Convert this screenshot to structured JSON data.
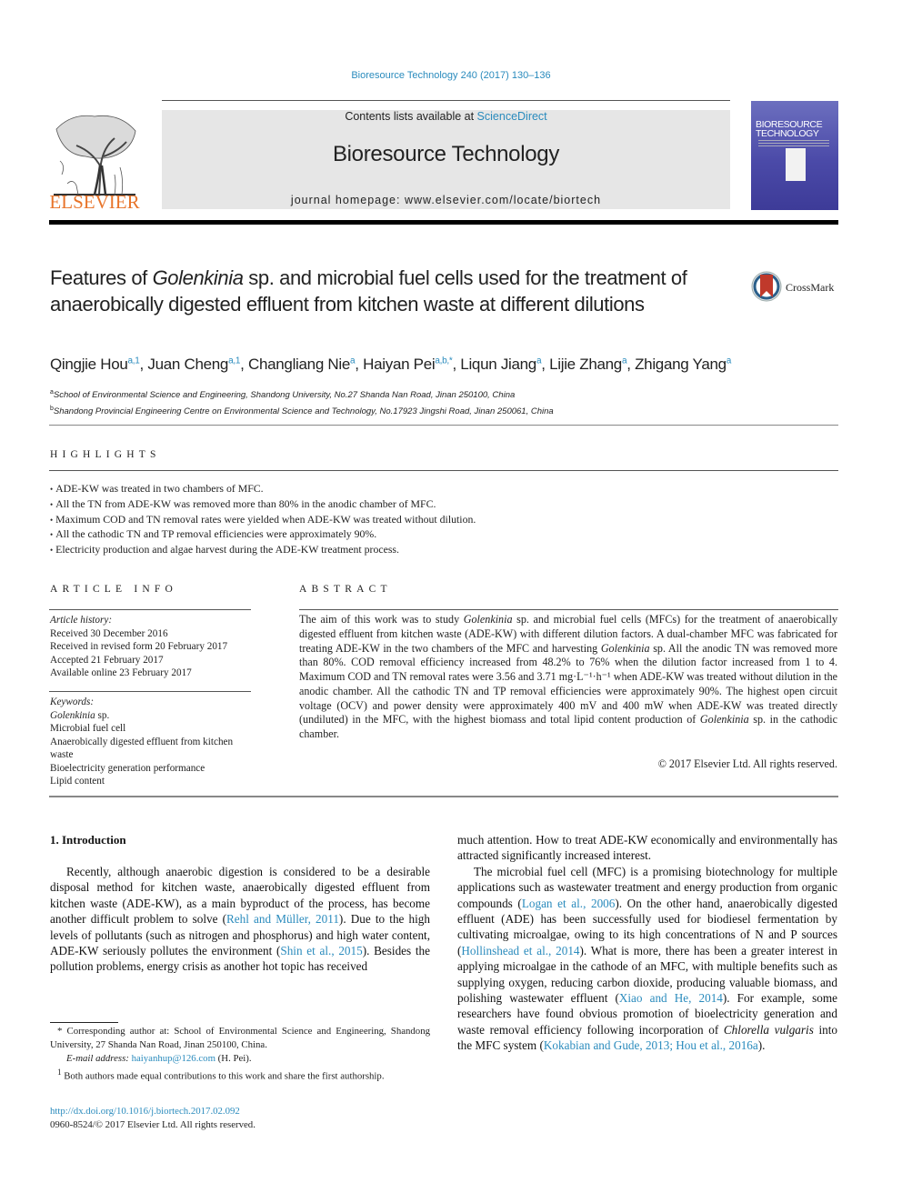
{
  "running_head": "Bioresource Technology 240 (2017) 130–136",
  "masthead": {
    "contents_prefix": "Contents lists available at ",
    "contents_link": "ScienceDirect",
    "journal_title": "Bioresource Technology",
    "homepage": "journal homepage: www.elsevier.com/locate/biortech",
    "publisher": "ELSEVIER",
    "cover_title_line1": "BIORESOURCE",
    "cover_title_line2": "TECHNOLOGY"
  },
  "crossmark_label": "CrossMark",
  "title": {
    "pre": "Features of ",
    "italic": "Golenkinia",
    "post": " sp. and microbial fuel cells used for the treatment of anaerobically digested effluent from kitchen waste at different dilutions"
  },
  "authors": [
    {
      "name": "Qingjie Hou",
      "sup": "a,1"
    },
    {
      "name": "Juan Cheng",
      "sup": "a,1"
    },
    {
      "name": "Changliang Nie",
      "sup": "a"
    },
    {
      "name": "Haiyan Pei",
      "sup": "a,b,*"
    },
    {
      "name": "Liqun Jiang",
      "sup": "a"
    },
    {
      "name": "Lijie Zhang",
      "sup": "a"
    },
    {
      "name": "Zhigang Yang",
      "sup": "a"
    }
  ],
  "affiliations": [
    {
      "mark": "a",
      "text": "School of Environmental Science and Engineering, Shandong University, No.27 Shanda Nan Road, Jinan 250100, China"
    },
    {
      "mark": "b",
      "text": "Shandong Provincial Engineering Centre on Environmental Science and Technology, No.17923 Jingshi Road, Jinan 250061, China"
    }
  ],
  "highlights": {
    "heading": "HIGHLIGHTS",
    "items": [
      "ADE-KW was treated in two chambers of MFC.",
      "All the TN from ADE-KW was removed more than 80% in the anodic chamber of MFC.",
      "Maximum COD and TN removal rates were yielded when ADE-KW was treated without dilution.",
      "All the cathodic TN and TP removal efficiencies were approximately 90%.",
      "Electricity production and algae harvest during the ADE-KW treatment process."
    ]
  },
  "article_info": {
    "heading": "ARTICLE INFO",
    "history_label": "Article history:",
    "history": [
      "Received 30 December 2016",
      "Received in revised form 20 February 2017",
      "Accepted 21 February 2017",
      "Available online 23 February 2017"
    ],
    "keywords_label": "Keywords:",
    "keyword_first_italic": "Golenkinia",
    "keyword_first_rest": " sp.",
    "keywords": [
      "Microbial fuel cell",
      "Anaerobically digested effluent from kitchen waste",
      "Bioelectricity generation performance",
      "Lipid content"
    ]
  },
  "abstract": {
    "heading": "ABSTRACT",
    "p1": "The aim of this work was to study ",
    "i1": "Golenkinia",
    "p2": " sp. and microbial fuel cells (MFCs) for the treatment of anaerobically digested effluent from kitchen waste (ADE-KW) with different dilution factors. A dual-chamber MFC was fabricated for treating ADE-KW in the two chambers of the MFC and harvesting ",
    "i2": "Golenkinia",
    "p3": " sp. All the anodic TN was removed more than 80%. COD removal efficiency increased from 48.2% to 76% when the dilution factor increased from 1 to 4. Maximum COD and TN removal rates were 3.56 and 3.71 mg·L⁻¹·h⁻¹ when ADE-KW was treated without dilution in the anodic chamber. All the cathodic TN and TP removal efficiencies were approximately 90%. The highest open circuit voltage (OCV) and power density were approximately 400 mV and 400 mW when ADE-KW was treated directly (undiluted) in the MFC, with the highest biomass and total lipid content production of ",
    "i3": "Golenkinia",
    "p4": " sp. in the cathodic chamber.",
    "copyright": "© 2017 Elsevier Ltd. All rights reserved."
  },
  "intro": {
    "heading": "1. Introduction",
    "left_p1_a": "Recently, although anaerobic digestion is considered to be a desirable disposal method for kitchen waste, anaerobically digested effluent from kitchen waste (ADE-KW), as a main byproduct of the process, has become another difficult problem to solve (",
    "left_cite1": "Rehl and Müller, 2011",
    "left_p1_b": "). Due to the high levels of pollutants (such as nitrogen and phosphorus) and high water content, ADE-KW seriously pollutes the environment (",
    "left_cite2": "Shin et al., 2015",
    "left_p1_c": "). Besides the pollution problems, energy crisis as another hot topic has received",
    "right_p1": "much attention. How to treat ADE-KW economically and environmentally has attracted significantly increased interest.",
    "right_p2_a": "The microbial fuel cell (MFC) is a promising biotechnology for multiple applications such as wastewater treatment and energy production from organic compounds (",
    "right_cite1": "Logan et al., 2006",
    "right_p2_b": "). On the other hand, anaerobically digested effluent (ADE) has been successfully used for biodiesel fermentation by cultivating microalgae, owing to its high concentrations of N and P sources (",
    "right_cite2": "Hollinshead et al., 2014",
    "right_p2_c": "). What is more, there has been a greater interest in applying microalgae in the cathode of an MFC, with multiple benefits such as supplying oxygen, reducing carbon dioxide, producing valuable biomass, and polishing wastewater effluent (",
    "right_cite3": "Xiao and He, 2014",
    "right_p2_d": "). For example, some researchers have found obvious promotion of bioelectricity generation and waste removal efficiency following incorporation of ",
    "right_italic": "Chlorella vulgaris",
    "right_p2_e": " into the MFC system (",
    "right_cite4": "Kokabian and Gude, 2013; Hou et al., 2016a",
    "right_p2_f": ")."
  },
  "footnotes": {
    "corresponding": "* Corresponding author at: School of Environmental Science and Engineering, Shandong University, 27 Shanda Nan Road, Jinan 250100, China.",
    "email_label": "E-mail address: ",
    "email": "haiyanhup@126.com",
    "email_suffix": " (H. Pei).",
    "equal_mark": "1",
    "equal": " Both authors made equal contributions to this work and share the first authorship."
  },
  "doi": "http://dx.doi.org/10.1016/j.biortech.2017.02.092",
  "issn": "0960-8524/© 2017 Elsevier Ltd. All rights reserved."
}
